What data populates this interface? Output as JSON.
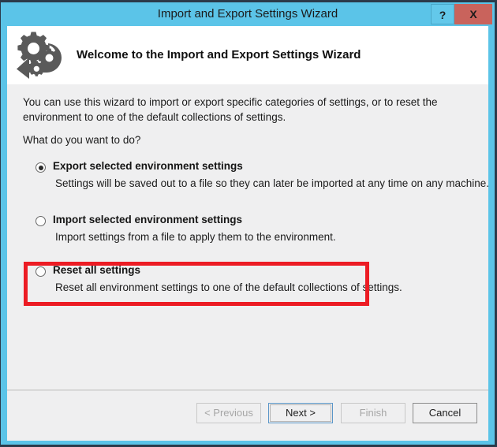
{
  "window": {
    "title": "Import and Export Settings Wizard",
    "help_label": "?",
    "close_label": "X",
    "chrome_color": "#5bc4e8",
    "close_color": "#c9635c"
  },
  "header": {
    "icon": "gears-refresh-icon",
    "title": "Welcome to the Import and Export Settings Wizard"
  },
  "body": {
    "intro": "You can use this wizard to import or export specific categories of settings, or to reset the environment to one of the default collections of settings.",
    "question": "What do you want to do?",
    "options": [
      {
        "id": "export",
        "label": "Export selected environment settings",
        "description": "Settings will be saved out to a file so they can later be imported at any time on any machine.",
        "selected": true
      },
      {
        "id": "import",
        "label": "Import selected environment settings",
        "description": "Import settings from a file to apply them to the environment.",
        "selected": false
      },
      {
        "id": "reset",
        "label": "Reset all settings",
        "description": "Reset all environment settings to one of the default collections of settings.",
        "selected": false
      }
    ],
    "highlight": {
      "target": "reset",
      "color": "#ec1c24"
    }
  },
  "footer": {
    "buttons": [
      {
        "id": "previous",
        "label": "< Previous",
        "enabled": false,
        "default": false
      },
      {
        "id": "next",
        "label": "Next >",
        "enabled": true,
        "default": true
      },
      {
        "id": "finish",
        "label": "Finish",
        "enabled": false,
        "default": false
      },
      {
        "id": "cancel",
        "label": "Cancel",
        "enabled": true,
        "default": false
      }
    ]
  }
}
